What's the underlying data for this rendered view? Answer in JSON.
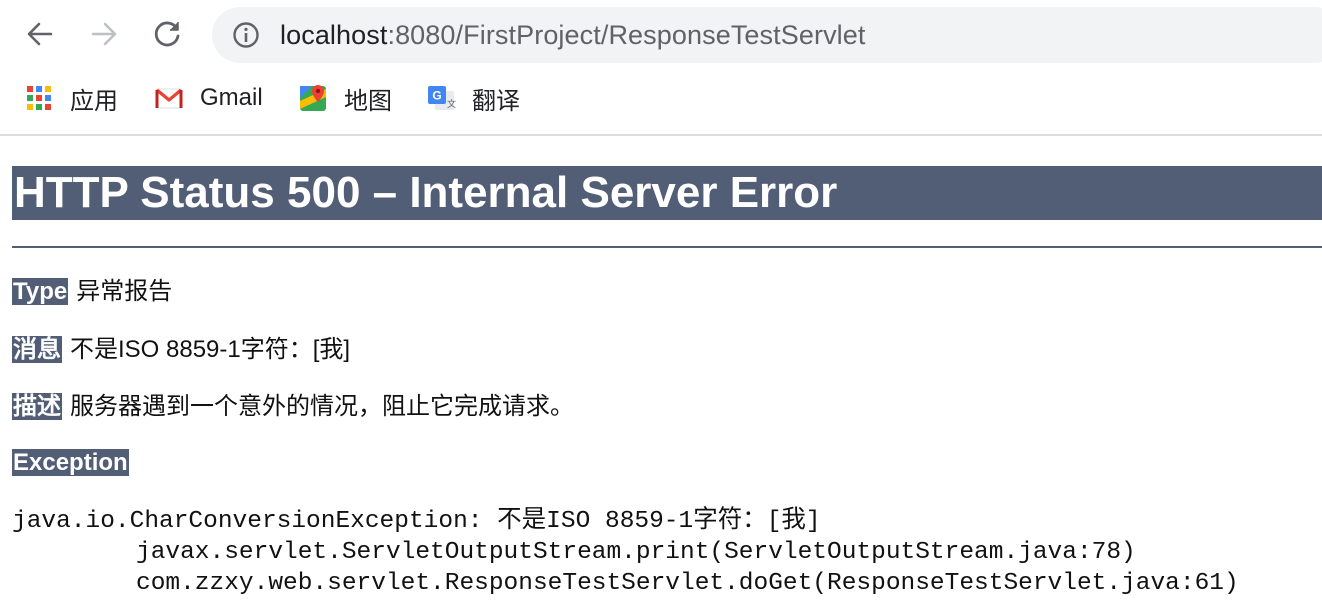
{
  "browser": {
    "back_icon": "arrow-left-icon",
    "forward_icon": "arrow-right-icon",
    "reload_icon": "reload-icon",
    "info_icon": "info-icon",
    "url_host": "localhost",
    "url_rest": ":8080/FirstProject/ResponseTestServlet"
  },
  "bookmarks": [
    {
      "label": "应用",
      "icon": "apps-grid-icon"
    },
    {
      "label": "Gmail",
      "icon": "gmail-icon"
    },
    {
      "label": "地图",
      "icon": "maps-icon"
    },
    {
      "label": "翻译",
      "icon": "translate-icon"
    }
  ],
  "page": {
    "title": "HTTP Status 500 – Internal Server Error",
    "type_label": "Type",
    "type_value": "异常报告",
    "message_label": "消息",
    "message_value": "不是ISO 8859-1字符：[我]",
    "description_label": "描述",
    "description_value": "服务器遇到一个意外的情况，阻止它完成请求。",
    "exception_label": "Exception",
    "stack": [
      "java.io.CharConversionException: 不是ISO 8859-1字符：[我]",
      "javax.servlet.ServletOutputStream.print(ServletOutputStream.java:78)",
      "com.zzxy.web.servlet.ResponseTestServlet.doGet(ResponseTestServlet.java:61)"
    ]
  },
  "colors": {
    "tomcat_header": "#525d76",
    "omnibox_bg": "#f1f3f4"
  }
}
